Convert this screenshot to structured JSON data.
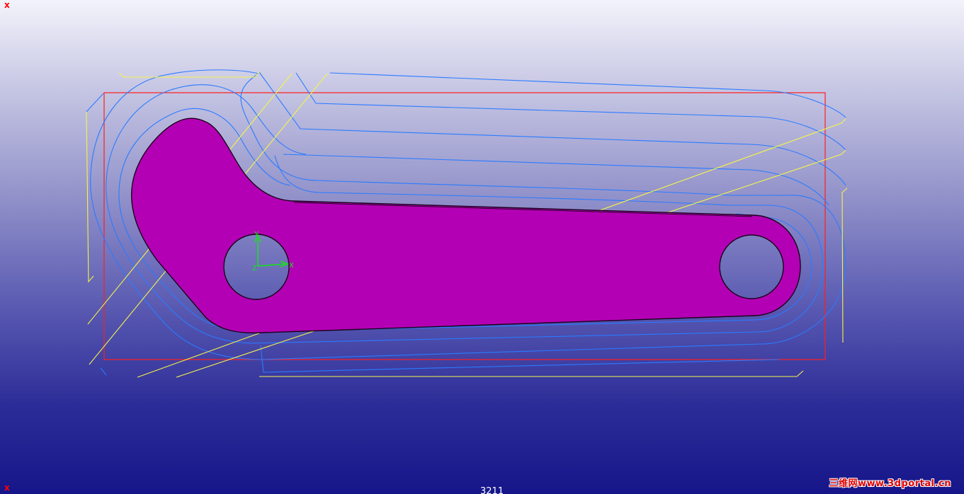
{
  "viewport": {
    "corner_top_left_label": "x",
    "corner_bottom_left_label": "x",
    "status_number": "3211",
    "watermark": "三维网www.3dportal.cn"
  },
  "colors": {
    "background_top": "#f3f3fb",
    "background_bottom": "#16168a",
    "part_fill": "#b400b4",
    "part_edge": "#1a001a",
    "toolpath_blue": "#2a7bff",
    "toolpath_yellow": "#f4f44a",
    "stock_boundary_red": "#ff1e1e",
    "axis_triad_green": "#13e613",
    "corner_marker_red": "#ff0000",
    "watermark_red": "#e00000"
  },
  "icons": {
    "triad": "xyz-axis-triad-icon",
    "corner": "close-x-icon"
  },
  "axis_triad": {
    "x_label": "X",
    "y_label": "Y",
    "z_label": "Z"
  }
}
